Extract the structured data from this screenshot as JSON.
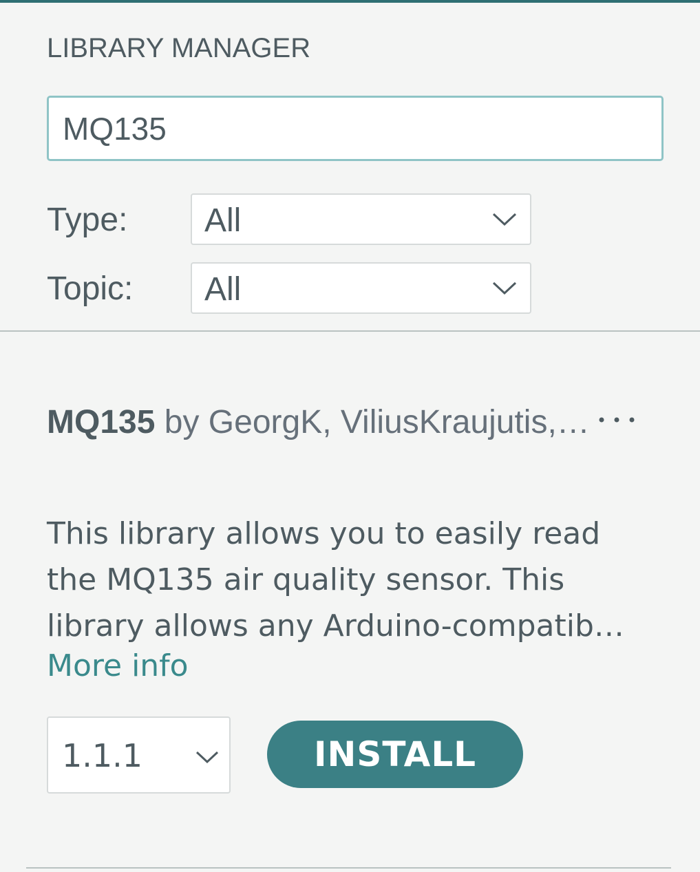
{
  "panel": {
    "title": "LIBRARY MANAGER"
  },
  "search": {
    "value": "MQ135",
    "placeholder": ""
  },
  "filters": {
    "type_label": "Type:",
    "type_value": "All",
    "topic_label": "Topic:",
    "topic_value": "All"
  },
  "library": {
    "name": "MQ135",
    "author_text": "by GeorgK, ViliusKraujutis,…",
    "description": "This library allows you to easily read\nthe MQ135 air quality sensor. This\nlibrary allows any Arduino-compatib…",
    "more_info_label": "More info",
    "version": "1.1.1",
    "install_label": "INSTALL"
  },
  "icons": {
    "chevron": "chevron-down-icon",
    "more": "more-options-icon"
  },
  "colors": {
    "accent": "#3b8085",
    "link": "#3a8a8c",
    "input_focus_border": "#8fc4c6",
    "background": "#f4f5f4"
  }
}
